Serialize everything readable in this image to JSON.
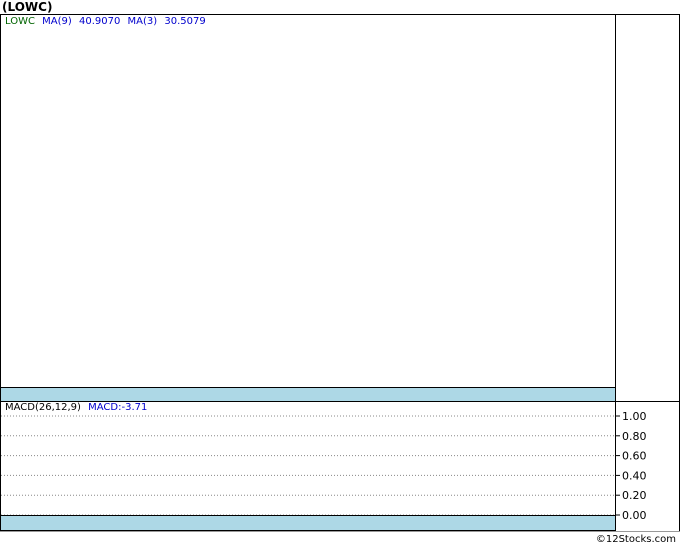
{
  "title": "(LOWC)",
  "price_legend": {
    "symbol": "LOWC",
    "ma9_label": "MA(9)",
    "ma9_value": "40.9070",
    "ma3_label": "MA(3)",
    "ma3_value": "30.5079"
  },
  "macd_legend": {
    "label": "MACD(26,12,9)",
    "value": "MACD:-3.71"
  },
  "footer": "©12Stocks.com",
  "colors": {
    "symbol": "#006400",
    "ma": "#0000cd",
    "band": "#add8e6",
    "grid": "#888888"
  },
  "chart_data": {
    "type": "line",
    "title": "(LOWC)",
    "series": [],
    "macd_axis": {
      "tick_labels": [
        "1.00",
        "0.80",
        "0.60",
        "0.40",
        "0.20",
        "0.00"
      ],
      "ticks": [
        1.0,
        0.8,
        0.6,
        0.4,
        0.2,
        0.0
      ],
      "ylim": [
        0,
        1
      ],
      "grid": true
    }
  }
}
